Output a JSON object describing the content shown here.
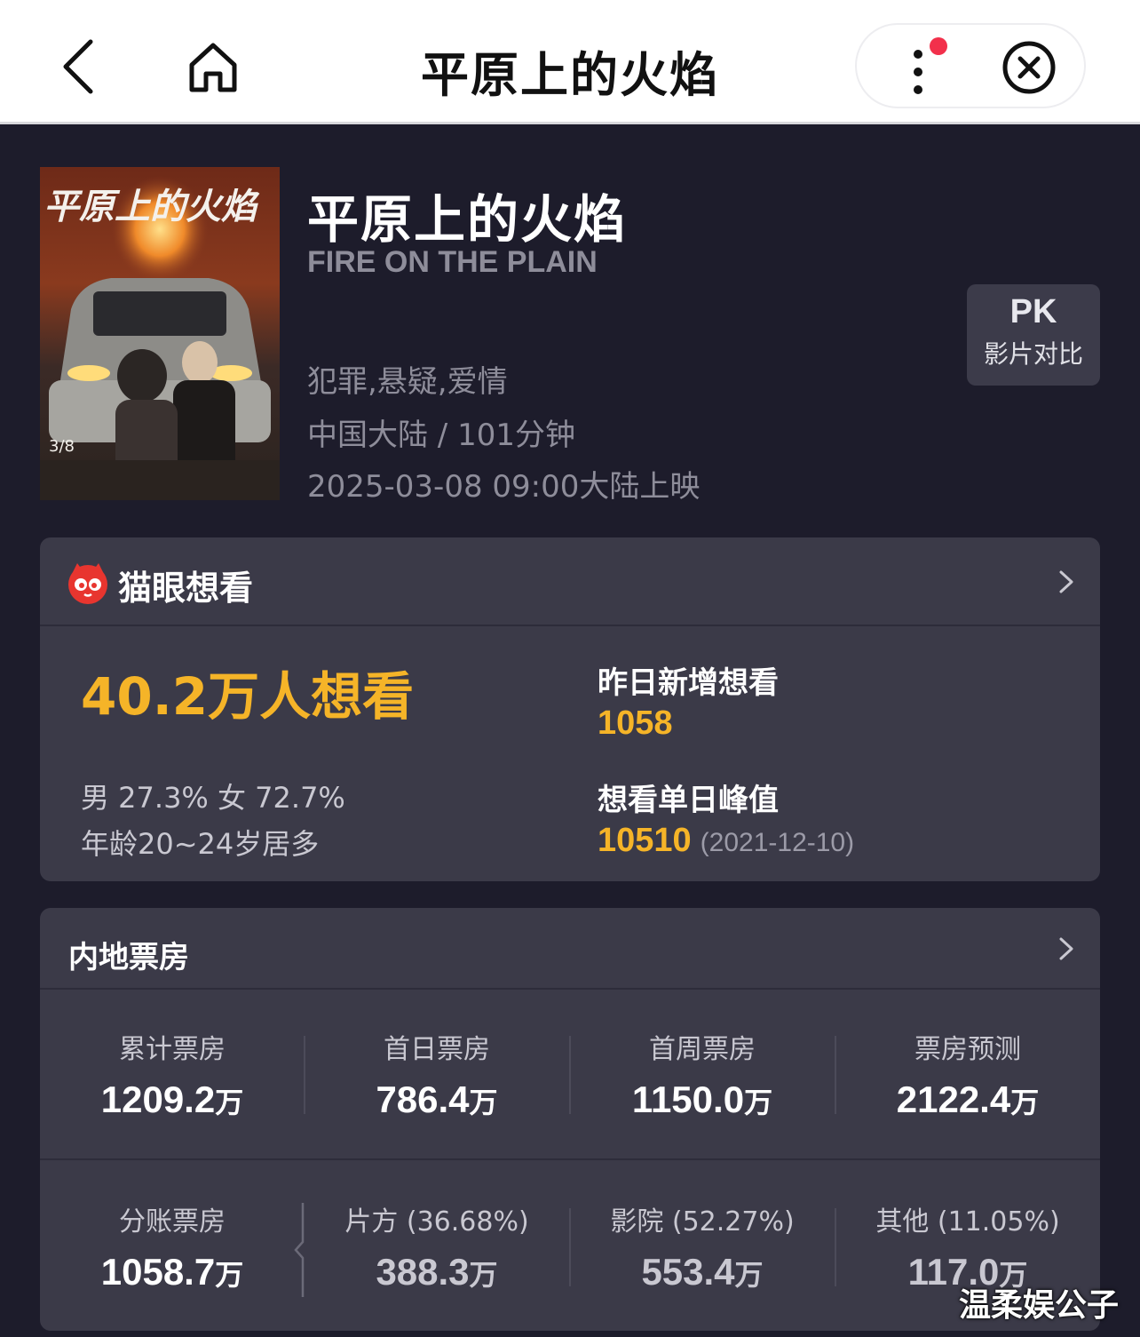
{
  "nav": {
    "title": "平原上的火焰",
    "back_icon": "chevron-left-icon",
    "home_icon": "home-icon",
    "more_icon": "more-vertical-icon",
    "close_icon": "close-circle-icon",
    "badge_color": "#f2304b"
  },
  "movie": {
    "title": "平原上的火焰",
    "english_title": "FIRE ON THE PLAIN",
    "genres": "犯罪,悬疑,爱情",
    "region_duration": "中国大陆 / 101分钟",
    "release": "2025-03-08 09:00大陆上映",
    "poster": {
      "title_text": "平原上的火焰",
      "date_text": "3/8"
    },
    "pk": {
      "label": "PK",
      "sub": "影片对比"
    }
  },
  "want": {
    "brand": "猫眼想看",
    "total": "40.2万人想看",
    "gender": "男 27.3% 女 72.7%",
    "age": "年龄20~24岁居多",
    "yesterday_label": "昨日新增想看",
    "yesterday_value": "1058",
    "peak_label": "想看单日峰值",
    "peak_value": "10510",
    "peak_date": "(2021-12-10)",
    "accent_color": "#f5b428"
  },
  "box_office": {
    "title": "内地票房",
    "row1": [
      {
        "label": "累计票房",
        "value": "1209.2",
        "unit": "万"
      },
      {
        "label": "首日票房",
        "value": "786.4",
        "unit": "万"
      },
      {
        "label": "首周票房",
        "value": "1150.0",
        "unit": "万"
      },
      {
        "label": "票房预测",
        "value": "2122.4",
        "unit": "万"
      }
    ],
    "row2": [
      {
        "label": "分账票房",
        "value": "1058.7",
        "unit": "万"
      },
      {
        "label": "片方 (36.68%)",
        "value": "388.3",
        "unit": "万"
      },
      {
        "label": "影院 (52.27%)",
        "value": "553.4",
        "unit": "万"
      },
      {
        "label": "其他 (11.05%)",
        "value": "117.0",
        "unit": "万"
      }
    ]
  },
  "watermark": "温柔娱公子"
}
